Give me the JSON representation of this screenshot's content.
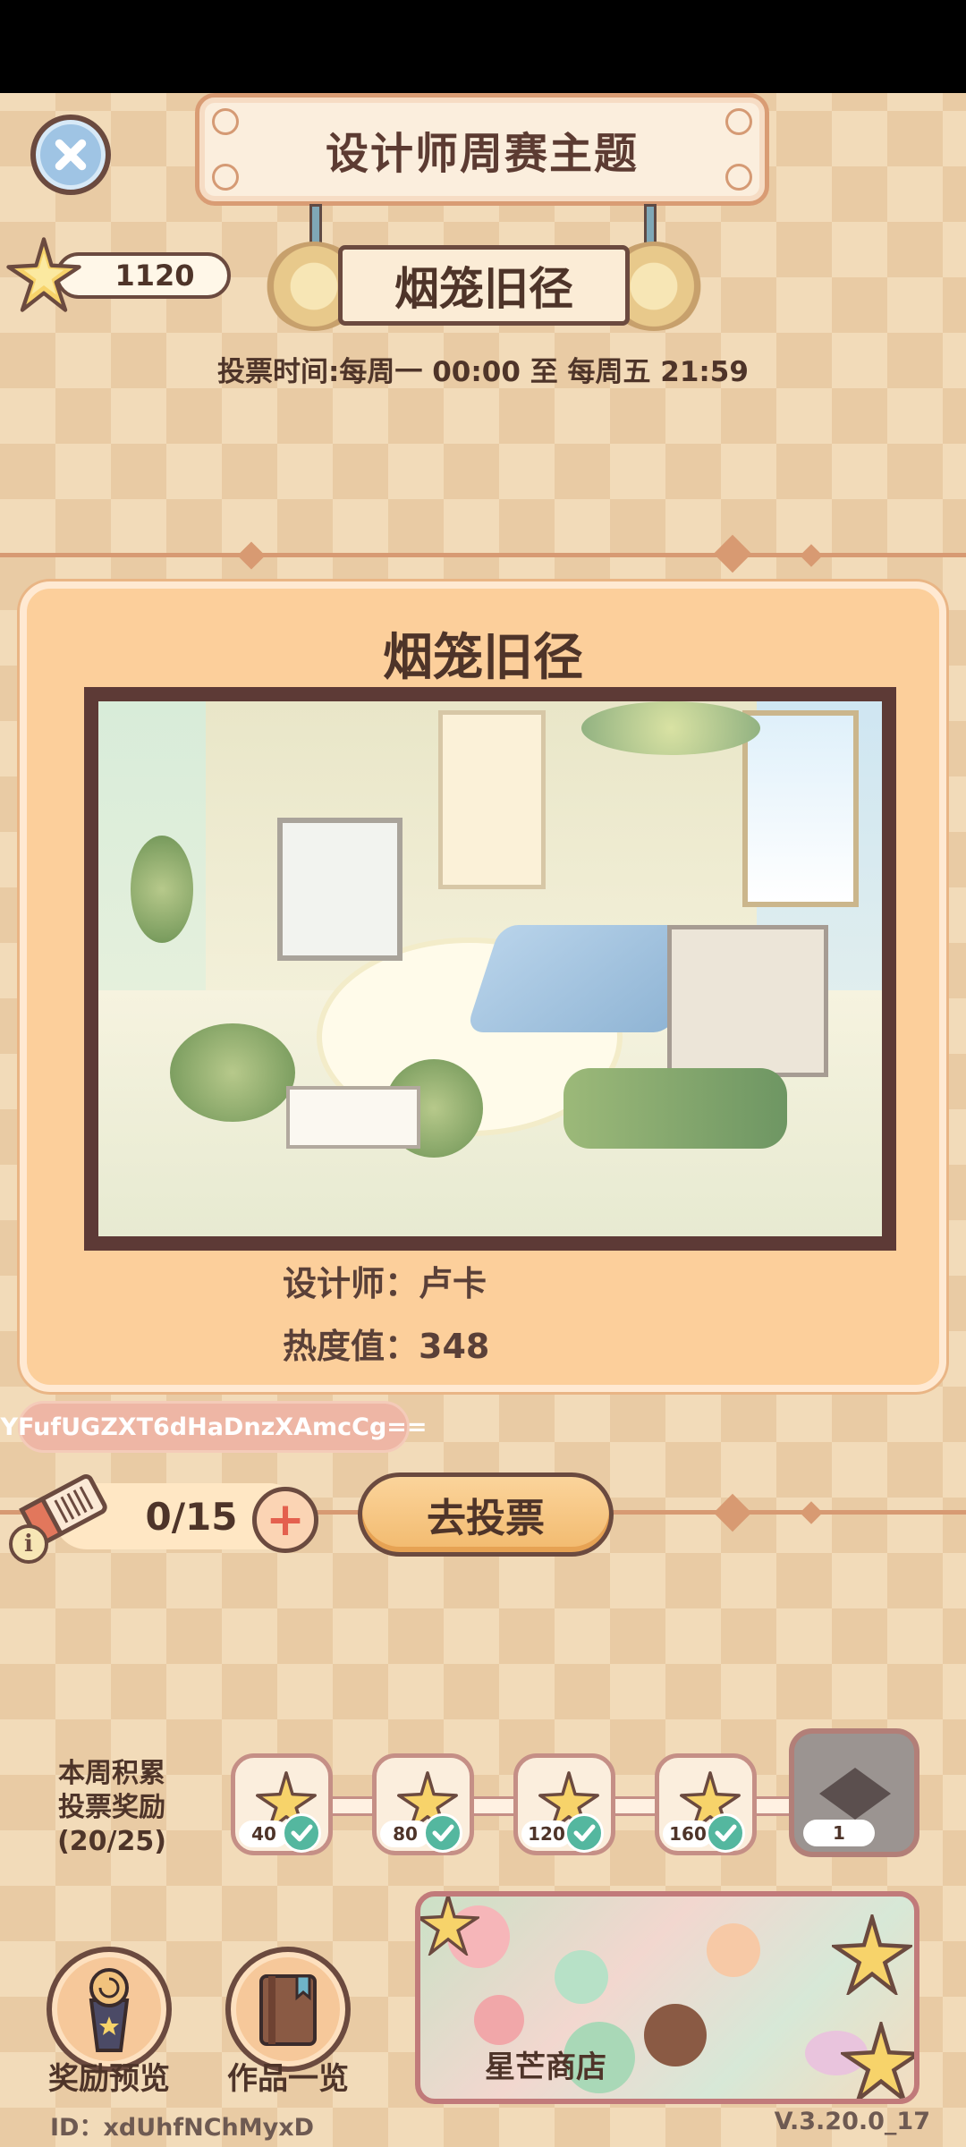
{
  "header": {
    "title": "设计师周赛主题",
    "theme_name": "烟笼旧径",
    "vote_time": "投票时间:每周一 00:00 至 每周五 21:59",
    "star_count": "1120"
  },
  "entry": {
    "title": "烟笼旧径",
    "designer": "设计师：卢卡",
    "heat": "热度值：348",
    "code": "YFufUGZXT6dHaDnzXAmcCg=="
  },
  "vote": {
    "tickets": "0/15",
    "go_vote_label": "去投票",
    "plus_symbol": "+",
    "info_symbol": "i"
  },
  "rewards": {
    "label_line1": "本周积累",
    "label_line2": "投票奖励",
    "label_line3": "(20/25)",
    "milestones": [
      {
        "count": "40",
        "claimed": true
      },
      {
        "count": "80",
        "claimed": true
      },
      {
        "count": "120",
        "claimed": true
      },
      {
        "count": "160",
        "claimed": true
      }
    ],
    "final": {
      "count": "1",
      "claimed": false
    }
  },
  "bottom": {
    "reward_preview_label": "奖励预览",
    "works_list_label": "作品一览",
    "shop_label": "星芒商店"
  },
  "footer": {
    "player_id": "ID：xdUhfNChMyxD",
    "version": "V.3.20.0_17"
  },
  "colors": {
    "accent": "#d79a73",
    "card_bg": "#fccf9b",
    "text_dark": "#4e3429",
    "check_green": "#54b79f"
  },
  "icons": [
    "close-icon",
    "star-icon",
    "ticket-icon",
    "info-icon",
    "plus-icon",
    "check-icon",
    "floor-tile-icon",
    "trophy-icon",
    "book-icon"
  ]
}
